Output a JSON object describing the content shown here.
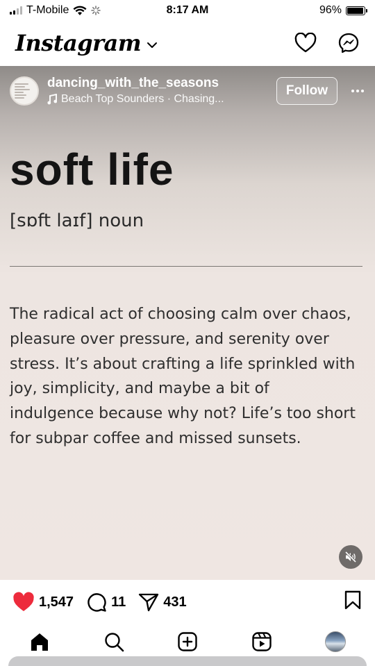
{
  "status_bar": {
    "carrier": "T-Mobile",
    "time": "8:17 AM",
    "battery_percent": "96%",
    "battery_level": 0.96
  },
  "header": {
    "logo_text": "Instagram"
  },
  "post": {
    "username": "dancing_with_the_seasons",
    "audio": "Beach Top Sounders · Chasing...",
    "follow_label": "Follow",
    "title": "soft life",
    "pronunciation": "[sɒft laɪf] noun",
    "definition": "The radical act of choosing calm over chaos, pleasure over pressure, and serenity over stress. It’s about crafting a life sprinkled with joy, simplicity, and maybe a bit of indulgence because why not? Life’s too short for subpar coffee and missed sunsets."
  },
  "actions": {
    "likes": "1,547",
    "comments": "11",
    "shares": "431"
  },
  "icons": {
    "like": "heart-filled-icon",
    "comment": "comment-icon",
    "share": "send-icon",
    "save": "bookmark-icon",
    "activity": "heart-outline-icon",
    "messenger": "messenger-icon",
    "mute": "speaker-muted-icon",
    "home": "home-icon",
    "search": "search-icon",
    "create": "plus-square-icon",
    "reels": "reels-icon"
  },
  "colors": {
    "like_red": "#ed2b3c",
    "text_dark": "#141414"
  }
}
